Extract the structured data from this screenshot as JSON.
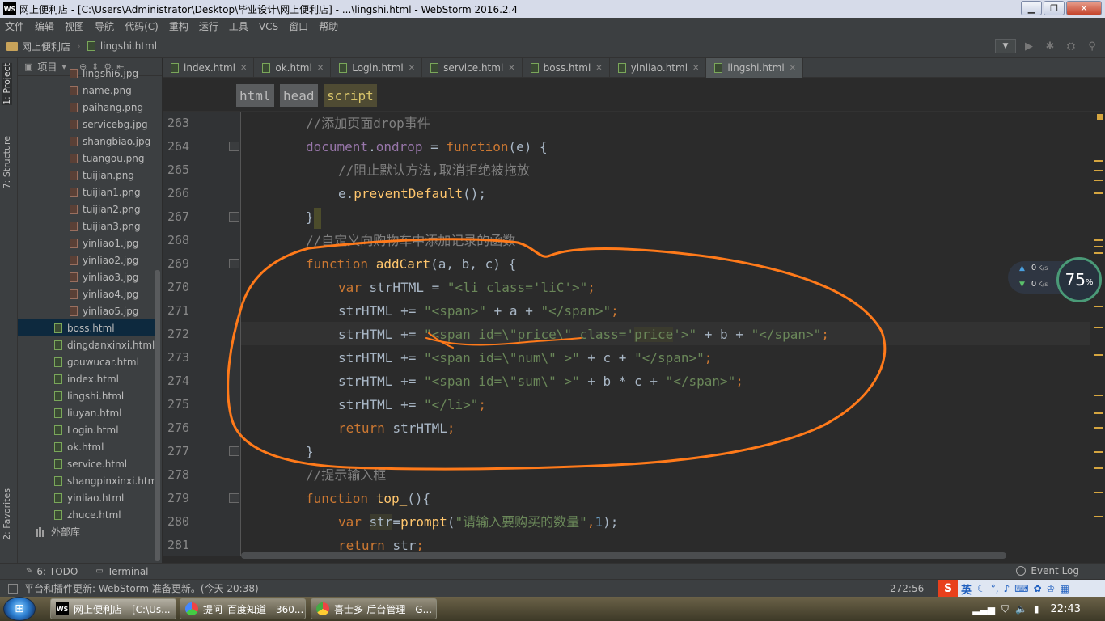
{
  "window": {
    "logo": "WS",
    "title": "网上便利店 - [C:\\Users\\Administrator\\Desktop\\毕业设计\\网上便利店] - ...\\lingshi.html - WebStorm 2016.2.4",
    "min": "▁",
    "max": "❐",
    "close": "✕"
  },
  "menu": [
    "文件",
    "编辑",
    "视图",
    "导航",
    "代码(C)",
    "重构",
    "运行",
    "工具",
    "VCS",
    "窗口",
    "帮助"
  ],
  "breadcrumb": {
    "project": "网上便利店",
    "file": "lingshi.html"
  },
  "leftstrip": {
    "project_tab": "1: Project",
    "structure_tab": "7: Structure",
    "favorites_tab": "2: Favorites"
  },
  "project_panel": {
    "view_label": "项目",
    "files_img": [
      "lingshi6.jpg",
      "name.png",
      "paihang.png",
      "servicebg.jpg",
      "shangbiao.jpg",
      "tuangou.png",
      "tuijian.png",
      "tuijian1.png",
      "tuijian2.png",
      "tuijian3.png",
      "yinliao1.jpg",
      "yinliao2.jpg",
      "yinliao3.jpg",
      "yinliao4.jpg",
      "yinliao5.jpg"
    ],
    "files_html": [
      "boss.html",
      "dingdanxinxi.html",
      "gouwucar.html",
      "index.html",
      "lingshi.html",
      "liuyan.html",
      "Login.html",
      "ok.html",
      "service.html",
      "shangpinxinxi.html",
      "yinliao.html",
      "zhuce.html"
    ],
    "selected": "boss.html",
    "external_libs": "外部库"
  },
  "tabs": [
    {
      "label": "index.html",
      "active": false
    },
    {
      "label": "ok.html",
      "active": false
    },
    {
      "label": "Login.html",
      "active": false
    },
    {
      "label": "service.html",
      "active": false
    },
    {
      "label": "boss.html",
      "active": false
    },
    {
      "label": "yinliao.html",
      "active": false
    },
    {
      "label": "lingshi.html",
      "active": true
    }
  ],
  "tag_path": [
    "html",
    "head",
    "script"
  ],
  "line_numbers": [
    "263",
    "264",
    "265",
    "266",
    "267",
    "268",
    "269",
    "270",
    "271",
    "272",
    "273",
    "274",
    "275",
    "276",
    "277",
    "278",
    "279",
    "280",
    "281"
  ],
  "code": {
    "l263": "//添加页面drop事件",
    "l264_a": "document",
    "l264_b": ".",
    "l264_c": "ondrop",
    "l264_d": " = ",
    "l264_e": "function",
    "l264_f": "(e) {",
    "l265": "//阻止默认方法,取消拒绝被拖放",
    "l266_a": "e.",
    "l266_b": "preventDefault",
    "l266_c": "();",
    "l267": "}",
    "l268": "//自定义向购物车中添加记录的函数",
    "l269_a": "function ",
    "l269_b": "addCart",
    "l269_c": "(a, b, c) {",
    "l270_a": "var ",
    "l270_b": "strHTML = ",
    "l270_c": "\"<li class='liC'>\"",
    "l270_d": ";",
    "l271_a": "strHTML += ",
    "l271_b": "\"<span>\"",
    "l271_c": " + a + ",
    "l271_d": "\"</span>\"",
    "l271_e": ";",
    "l272_a": "strHTML += ",
    "l272_b": "\"<span id=\\\"price\\\" class='",
    "l272_c": "price",
    "l272_d": "'>\"",
    "l272_e": " + b + ",
    "l272_f": "\"</span>\"",
    "l272_g": ";",
    "l273_a": "strHTML += ",
    "l273_b": "\"<span id=\\\"num\\\" >\"",
    "l273_c": " + c + ",
    "l273_d": "\"</span>\"",
    "l273_e": ";",
    "l274_a": "strHTML += ",
    "l274_b": "\"<span id=\\\"sum\\\" >\"",
    "l274_c": " + b * c + ",
    "l274_d": "\"</span>\"",
    "l274_e": ";",
    "l275_a": "strHTML += ",
    "l275_b": "\"</li>\"",
    "l275_c": ";",
    "l276_a": "return ",
    "l276_b": "strHTML",
    "l276_c": ";",
    "l277": "}",
    "l278": "//提示输入框",
    "l279_a": "function ",
    "l279_b": "top_",
    "l279_c": "(){",
    "l280_a": "var ",
    "l280_b": "str",
    "l280_c": "=",
    "l280_d": "prompt",
    "l280_e": "(",
    "l280_f": "\"请输入要购买的数量\"",
    "l280_g": ",",
    "l280_h": "1",
    "l280_i": ");",
    "l281_a": "return ",
    "l281_b": "str",
    "l281_c": ";"
  },
  "net_widget": {
    "up": "0",
    "down": "0",
    "unit": "K/s",
    "percent": "75",
    "percent_sign": "%"
  },
  "bottom_tools": {
    "todo": "6: TODO",
    "terminal": "Terminal",
    "event_log": "Event Log"
  },
  "status": {
    "message": "平台和插件更新: WebStorm 准备更新。(今天 20:38)",
    "position": "272:56",
    "ime_logo": "S",
    "ime_mode": "英"
  },
  "taskbar": {
    "items": [
      {
        "label": "网上便利店 - [C:\\Us...",
        "active": true
      },
      {
        "label": "提问_百度知道 - 360...",
        "active": false
      },
      {
        "label": "喜士多-后台管理 - G...",
        "active": false
      }
    ],
    "clock": "22:43"
  },
  "colors": {
    "editor_bg": "#2b2b2b",
    "keyword": "#cc7832",
    "comment": "#808080",
    "string": "#6a8759",
    "function": "#ffc66d",
    "property": "#9876aa",
    "annotation": "#ff7a1a"
  }
}
